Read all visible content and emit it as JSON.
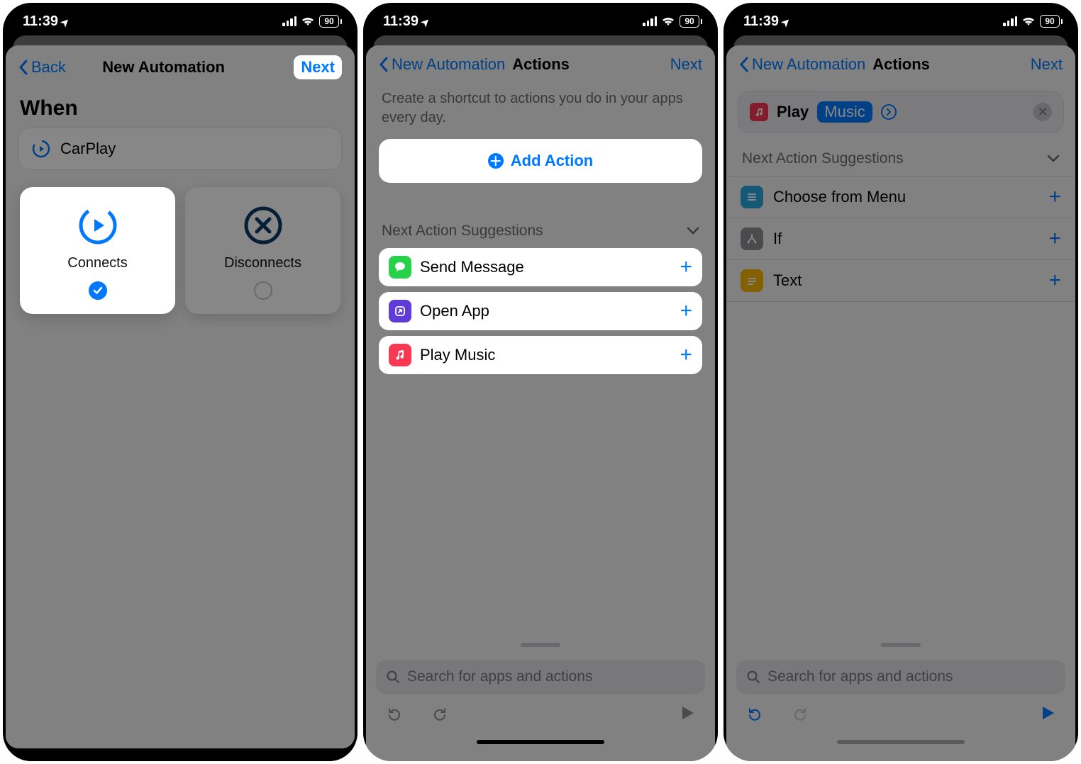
{
  "status": {
    "time": "11:39",
    "battery": "90"
  },
  "panel1": {
    "back": "Back",
    "title": "New Automation",
    "next": "Next",
    "when_header": "When",
    "trigger_name": "CarPlay",
    "options": [
      {
        "label": "Connects",
        "selected": true
      },
      {
        "label": "Disconnects",
        "selected": false
      }
    ]
  },
  "panel2": {
    "back": "New Automation",
    "title": "Actions",
    "next": "Next",
    "subtext": "Create a shortcut to actions you do in your apps every day.",
    "add_action": "Add Action",
    "suggest_header": "Next Action Suggestions",
    "suggestions": [
      {
        "label": "Send Message"
      },
      {
        "label": "Open App"
      },
      {
        "label": "Play Music"
      }
    ],
    "search_placeholder": "Search for apps and actions"
  },
  "panel3": {
    "back": "New Automation",
    "title": "Actions",
    "next": "Next",
    "action_verb": "Play",
    "action_param": "Music",
    "suggest_header": "Next Action Suggestions",
    "suggestions": [
      {
        "label": "Choose from Menu"
      },
      {
        "label": "If"
      },
      {
        "label": "Text"
      }
    ],
    "search_placeholder": "Search for apps and actions"
  }
}
